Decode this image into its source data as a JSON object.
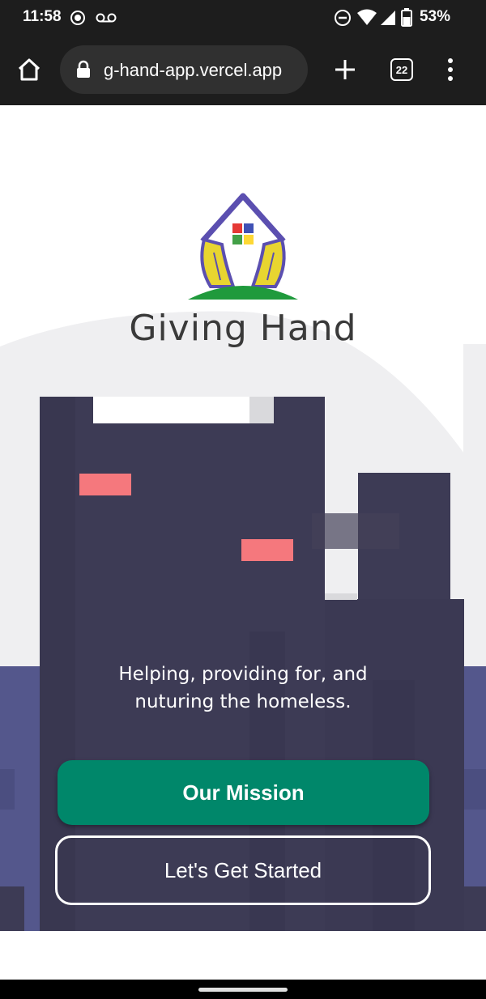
{
  "status_bar": {
    "time": "11:58",
    "battery": "53%",
    "icons": [
      "screen-record-icon",
      "voicemail-icon",
      "dnd-icon",
      "wifi-icon",
      "signal-icon",
      "battery-icon"
    ]
  },
  "browser": {
    "url": "g-hand-app.vercel.app",
    "tab_count": "22",
    "icons": [
      "home-icon",
      "lock-icon",
      "new-tab-icon",
      "tabs-icon",
      "menu-icon"
    ]
  },
  "hero": {
    "brand_name": "Giving Hand",
    "tagline_line1": "Helping, providing for, and",
    "tagline_line2": "nuturing the homeless.",
    "primary_button": "Our Mission",
    "secondary_button": "Let's Get Started"
  },
  "colors": {
    "primary": "#00876a",
    "building_dark": "#3d3b55",
    "building_blue": "#54578c",
    "window_pink": "#f5787d",
    "logo_purple": "#5b4fb0",
    "logo_yellow": "#e8d530"
  }
}
